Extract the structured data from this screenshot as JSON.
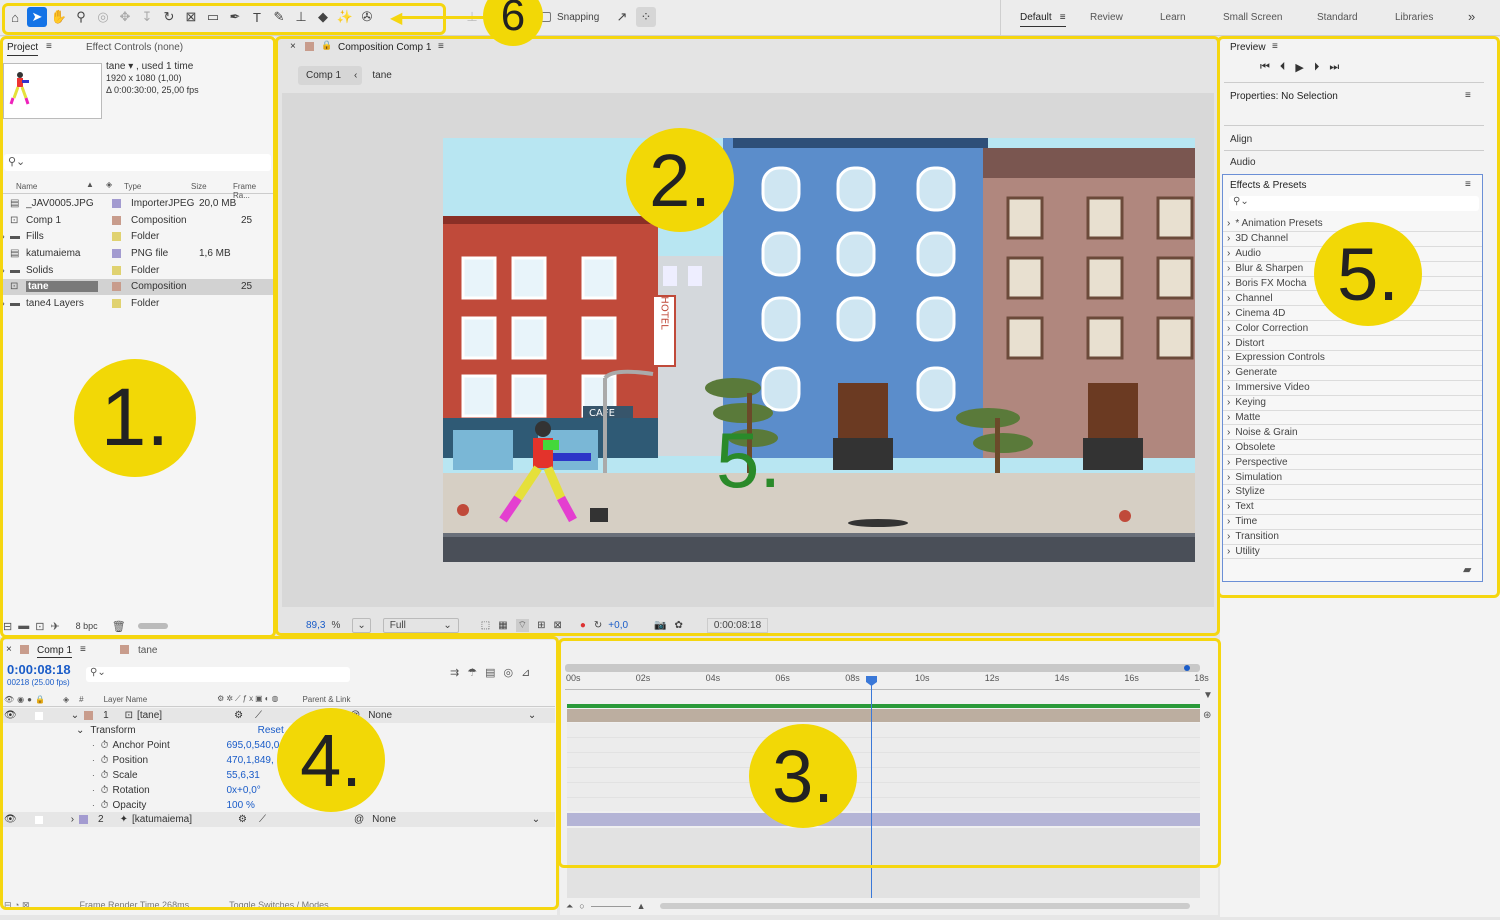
{
  "toolbar": {
    "snapping_label": "Snapping",
    "workspaces": [
      "Default",
      "Review",
      "Learn",
      "Small Screen",
      "Standard",
      "Libraries"
    ],
    "overflow": "»"
  },
  "project": {
    "tab_project": "Project",
    "tab_effect_controls": "Effect Controls (none)",
    "preview_name": "tane ▾ , used 1 time",
    "preview_res": "1920 x 1080 (1,00)",
    "preview_dur": "Δ 0:00:30:00, 25,00 fps",
    "search_placeholder": "",
    "columns": {
      "name": "Name",
      "type": "Type",
      "size": "Size",
      "frame_rate": "Frame Ra..."
    },
    "items": [
      {
        "name": "_JAV0005.JPG",
        "type": "ImporterJPEG",
        "size": "20,0 MB",
        "fps": "",
        "color": "#a39bd0"
      },
      {
        "name": "Comp 1",
        "type": "Composition",
        "size": "",
        "fps": "25",
        "color": "#c89c8c"
      },
      {
        "name": "Fills",
        "type": "Folder",
        "size": "",
        "fps": "",
        "color": "#e0d270"
      },
      {
        "name": "katumaiema",
        "type": "PNG file",
        "size": "1,6 MB",
        "fps": "",
        "color": "#a39bd0"
      },
      {
        "name": "Solids",
        "type": "Folder",
        "size": "",
        "fps": "",
        "color": "#e0d270"
      },
      {
        "name": "tane",
        "type": "Composition",
        "size": "",
        "fps": "25",
        "color": "#c89c8c"
      },
      {
        "name": "tane4 Layers",
        "type": "Folder",
        "size": "",
        "fps": "",
        "color": "#e0d270"
      }
    ],
    "bpc": "8 bpc"
  },
  "comp": {
    "tab_label": "Composition Comp 1",
    "crumbs": [
      "Comp 1",
      "tane"
    ],
    "zoom": "89,3",
    "zoom_unit": "%",
    "resolution": "Full",
    "exposure": "+0,0",
    "timecode": "0:00:08:18",
    "scene_signs": {
      "hotel": "HOTEL",
      "cafe": "CAFE"
    }
  },
  "right": {
    "preview_title": "Preview",
    "properties_title": "Properties: No Selection",
    "align": "Align",
    "audio": "Audio",
    "effects_title": "Effects & Presets",
    "effects": [
      "* Animation Presets",
      "3D Channel",
      "Audio",
      "Blur & Sharpen",
      "Boris FX Mocha",
      "Channel",
      "Cinema 4D",
      "Color Correction",
      "Distort",
      "Expression Controls",
      "Generate",
      "Immersive Video",
      "Keying",
      "Matte",
      "Noise & Grain",
      "Obsolete",
      "Perspective",
      "Simulation",
      "Stylize",
      "Text",
      "Time",
      "Transition",
      "Utility"
    ]
  },
  "timeline": {
    "tab_comp": "Comp 1",
    "tab_tane": "tane",
    "timecode": "0:00:08:18",
    "frame_info": "00218 (25.00 fps)",
    "col_num": "#",
    "col_layer_name": "Layer Name",
    "col_parent": "Parent & Link",
    "layer1": {
      "num": "1",
      "name": "[tane]",
      "parent": "None"
    },
    "transform_label": "Transform",
    "reset_label": "Reset",
    "props": [
      {
        "name": "Anchor Point",
        "value": "695,0,540,0"
      },
      {
        "name": "Position",
        "value": "470,1,849,"
      },
      {
        "name": "Scale",
        "value": "55,6,31"
      },
      {
        "name": "Rotation",
        "value": "0x+0,0°"
      },
      {
        "name": "Opacity",
        "value": "100 %"
      }
    ],
    "layer2": {
      "num": "2",
      "name": "[katumaiema]",
      "parent": "None"
    },
    "footer_render": "Frame Render Time 268ms",
    "footer_toggle": "Toggle Switches / Modes",
    "ruler": [
      "00s",
      "02s",
      "04s",
      "06s",
      "08s",
      "10s",
      "12s",
      "14s",
      "16s",
      "18s"
    ]
  },
  "annotations": [
    "1.",
    "2.",
    "3.",
    "4.",
    "5.",
    "5.",
    "6"
  ],
  "colors": {
    "accent": "#1a5cc8",
    "annotation": "#f2d806",
    "timeline_bar1": "#bcaea0",
    "timeline_bar2": "#b4b4d6",
    "work_area": "#2a9a3a"
  }
}
